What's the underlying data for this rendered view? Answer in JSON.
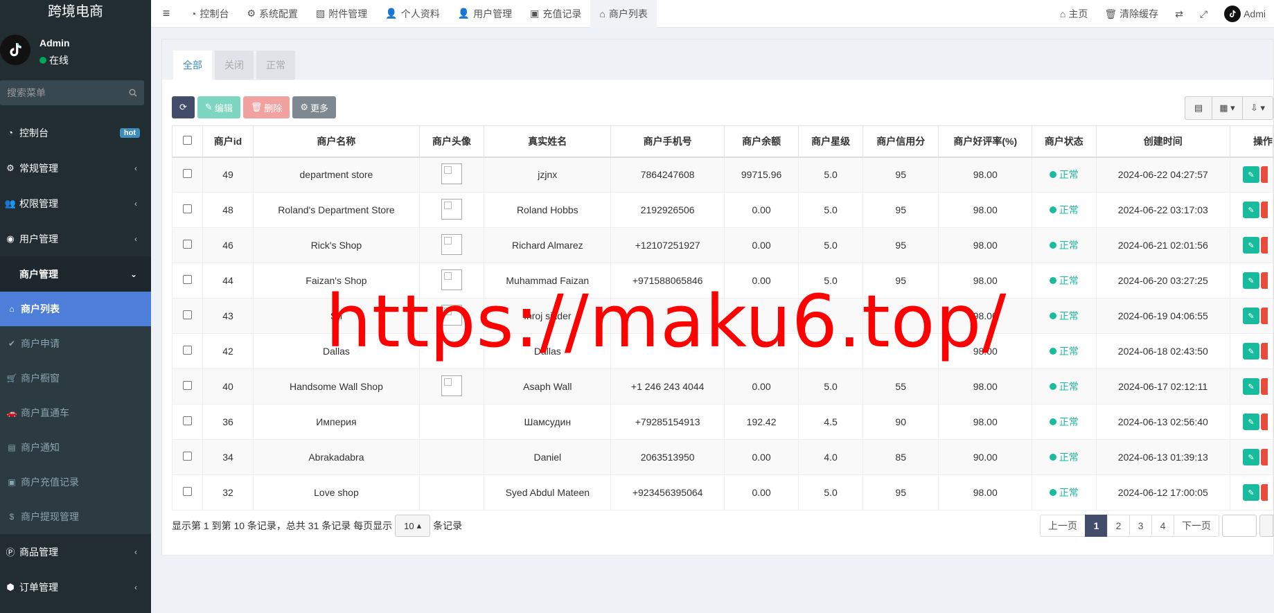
{
  "app": {
    "logo": "跨境电商",
    "user": {
      "name": "Admin",
      "status": "在线"
    },
    "search_placeholder": "搜索菜单"
  },
  "sidebar": {
    "items": [
      {
        "label": "控制台",
        "icon": "dashboard-icon",
        "badge": "hot"
      },
      {
        "label": "常规管理",
        "icon": "cogs-icon"
      },
      {
        "label": "权限管理",
        "icon": "group-icon"
      },
      {
        "label": "用户管理",
        "icon": "user-circle-icon"
      },
      {
        "label": "商户管理",
        "icon": "apple-icon",
        "open": true
      }
    ],
    "submenu": [
      {
        "label": "商户列表",
        "icon": "home-icon",
        "active": true
      },
      {
        "label": "商户申请",
        "icon": "check-circle-icon"
      },
      {
        "label": "商户橱窗",
        "icon": "cart-icon"
      },
      {
        "label": "商户直通车",
        "icon": "car-icon"
      },
      {
        "label": "商户通知",
        "icon": "notice-icon"
      },
      {
        "label": "商户充值记录",
        "icon": "money-icon"
      },
      {
        "label": "商户提现管理",
        "icon": "dollar-icon"
      }
    ],
    "bottom_items": [
      {
        "label": "商品管理",
        "icon": "product-hunt-icon"
      },
      {
        "label": "订单管理",
        "icon": "cube-icon"
      }
    ]
  },
  "topnav": {
    "tabs": [
      {
        "label": "控制台",
        "icon": "dashboard-icon"
      },
      {
        "label": "系统配置",
        "icon": "cog-icon"
      },
      {
        "label": "附件管理",
        "icon": "file-image-icon"
      },
      {
        "label": "个人资料",
        "icon": "user-icon"
      },
      {
        "label": "用户管理",
        "icon": "user-icon"
      },
      {
        "label": "充值记录",
        "icon": "money-icon"
      },
      {
        "label": "商户列表",
        "icon": "home-icon",
        "active": true
      }
    ],
    "right": {
      "home": "主页",
      "clear_cache": "清除缓存",
      "user": "Admi"
    }
  },
  "content": {
    "filter_tabs": [
      "全部",
      "关闭",
      "正常"
    ],
    "toolbar": {
      "edit": "编辑",
      "delete": "删除",
      "more": "更多"
    },
    "columns": [
      "商户id",
      "商户名称",
      "商户头像",
      "真实姓名",
      "商户手机号",
      "商户余额",
      "商户星级",
      "商户信用分",
      "商户好评率(%)",
      "商户状态",
      "创建时间",
      "操作"
    ],
    "rows": [
      {
        "id": "49",
        "name": "department store",
        "avatar": true,
        "real_name": "jzjnx",
        "phone": "7864247608",
        "balance": "99715.96",
        "stars": "5.0",
        "credit": "95",
        "rating": "98.00",
        "status": "正常",
        "created": "2024-06-22 04:27:57"
      },
      {
        "id": "48",
        "name": "Roland's Department Store",
        "avatar": true,
        "real_name": "Roland Hobbs",
        "phone": "2192926506",
        "balance": "0.00",
        "stars": "5.0",
        "credit": "95",
        "rating": "98.00",
        "status": "正常",
        "created": "2024-06-22 03:17:03"
      },
      {
        "id": "46",
        "name": "Rick's Shop",
        "avatar": true,
        "real_name": "Richard Almarez",
        "phone": "+12107251927",
        "balance": "0.00",
        "stars": "5.0",
        "credit": "95",
        "rating": "98.00",
        "status": "正常",
        "created": "2024-06-21 02:01:56"
      },
      {
        "id": "44",
        "name": "Faizan's Shop",
        "avatar": true,
        "real_name": "Muhammad Faizan",
        "phone": "+971588065846",
        "balance": "0.00",
        "stars": "5.0",
        "credit": "95",
        "rating": "98.00",
        "status": "正常",
        "created": "2024-06-20 03:27:25"
      },
      {
        "id": "43",
        "name": "Sh",
        "avatar": true,
        "real_name": "Inroj sikder",
        "phone": "",
        "balance": "",
        "stars": "",
        "credit": "",
        "rating": "98.00",
        "status": "正常",
        "created": "2024-06-19 04:06:55"
      },
      {
        "id": "42",
        "name": "Dallas",
        "avatar": false,
        "real_name": "Dallas",
        "phone": "",
        "balance": "",
        "stars": "",
        "credit": "",
        "rating": "98.00",
        "status": "正常",
        "created": "2024-06-18 02:43:50"
      },
      {
        "id": "40",
        "name": "Handsome Wall Shop",
        "avatar": true,
        "real_name": "Asaph Wall",
        "phone": "+1 246 243 4044",
        "balance": "0.00",
        "stars": "5.0",
        "credit": "55",
        "rating": "98.00",
        "status": "正常",
        "created": "2024-06-17 02:12:11"
      },
      {
        "id": "36",
        "name": "Империя",
        "avatar": false,
        "real_name": "Шамсудин",
        "phone": "+79285154913",
        "balance": "192.42",
        "stars": "4.5",
        "credit": "90",
        "rating": "98.00",
        "status": "正常",
        "created": "2024-06-13 02:56:40"
      },
      {
        "id": "34",
        "name": "Abrakadabra",
        "avatar": false,
        "real_name": "Daniel",
        "phone": "2063513950",
        "balance": "0.00",
        "stars": "4.0",
        "credit": "85",
        "rating": "90.00",
        "status": "正常",
        "created": "2024-06-13 01:39:13"
      },
      {
        "id": "32",
        "name": "Love shop",
        "avatar": false,
        "real_name": "Syed Abdul Mateen",
        "phone": "+923456395064",
        "balance": "0.00",
        "stars": "5.0",
        "credit": "95",
        "rating": "98.00",
        "status": "正常",
        "created": "2024-06-12 17:00:05"
      }
    ],
    "footer": {
      "summary": "显示第 1 到第 10 条记录，总共 31 条记录 每页显示",
      "page_size": "10",
      "suffix": "条记录"
    },
    "pager": {
      "prev": "上一页",
      "pages": [
        "1",
        "2",
        "3",
        "4"
      ],
      "next": "下一页",
      "current": "1"
    }
  },
  "watermark": "https://maku6.top/",
  "colors": {
    "sidebar_bg": "#222d32",
    "active_blue": "#4d7ed9",
    "status_green": "#18bc9c"
  }
}
